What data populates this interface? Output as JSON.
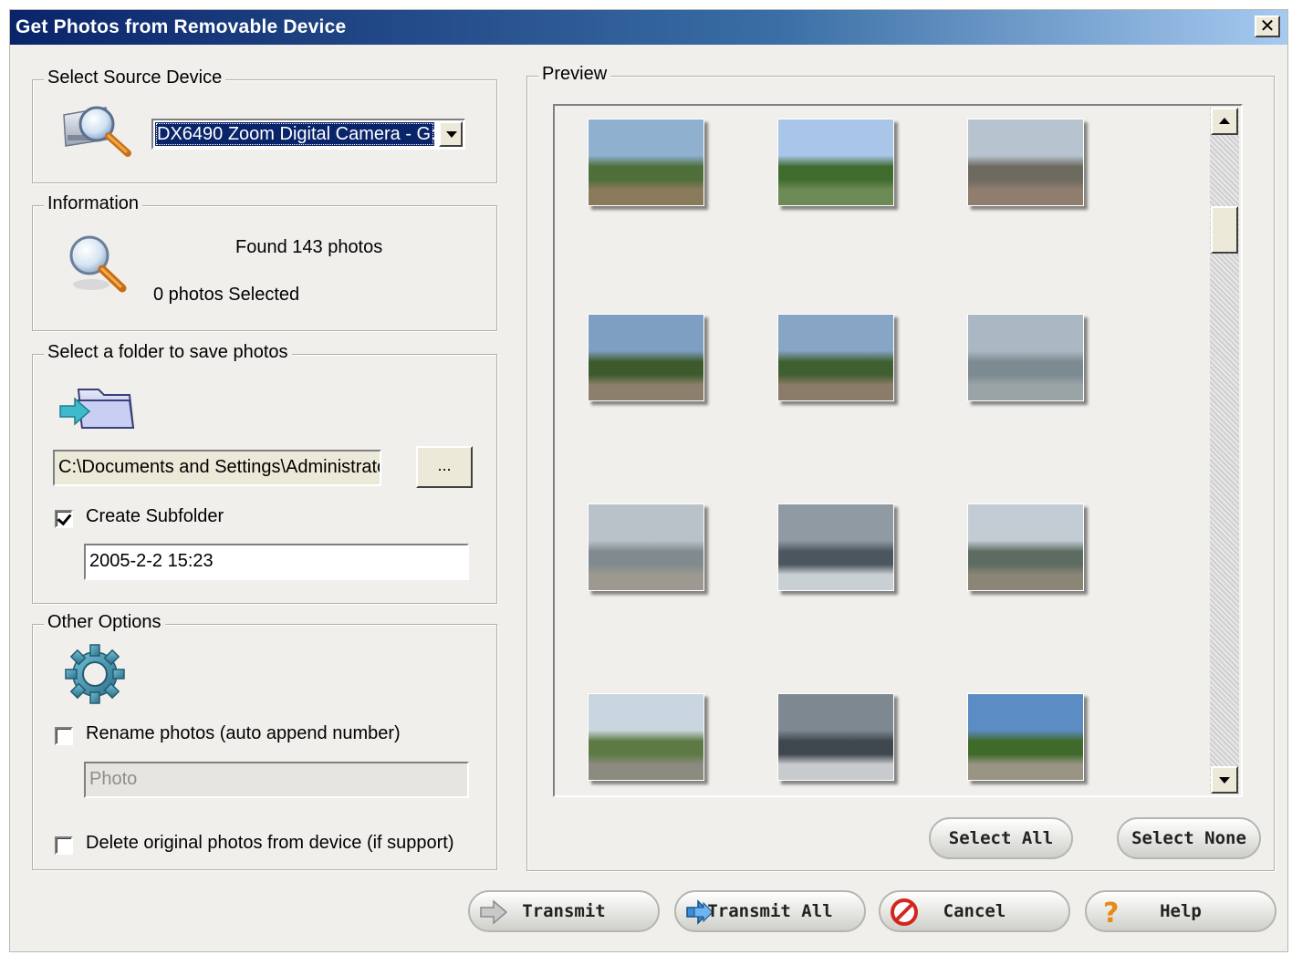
{
  "window": {
    "title": "Get Photos from Removable Device",
    "close_label": "✕"
  },
  "source": {
    "legend": "Select Source Device",
    "device_value": "DX6490 Zoom Digital Camera - G:",
    "device_icon": "device-search-icon"
  },
  "info": {
    "legend": "Information",
    "found_text": "Found 143 photos",
    "selected_text": "0 photos Selected",
    "info_icon": "magnifier-icon"
  },
  "folder": {
    "legend": "Select a folder to save photos",
    "path_value": "C:\\Documents and Settings\\Administrator\\My Documents",
    "browse_label": "...",
    "create_subfolder_label": "Create Subfolder",
    "create_subfolder_checked": true,
    "subfolder_value": "2005-2-2 15:23",
    "folder_icon": "folder-import-icon"
  },
  "options": {
    "legend": "Other Options",
    "rename_label": "Rename photos (auto append number)",
    "rename_checked": false,
    "rename_placeholder": "Photo",
    "delete_label": "Delete original photos from device (if support)",
    "delete_checked": false,
    "options_icon": "gear-icon"
  },
  "preview": {
    "legend": "Preview",
    "select_all_label": "Select All",
    "select_none_label": "Select None",
    "thumbnails": [
      {
        "scene": "palm-shore",
        "colors": [
          "#8fb0cf",
          "#4e6e3a",
          "#8a7a5c"
        ]
      },
      {
        "scene": "hill-house",
        "colors": [
          "#a9c6e8",
          "#3f6b2e",
          "#6c8a55"
        ]
      },
      {
        "scene": "promenade-rail",
        "colors": [
          "#b7c4cf",
          "#6d6a60",
          "#8f7e6e"
        ]
      },
      {
        "scene": "promenade-trees",
        "colors": [
          "#7f9fc2",
          "#3d5a2c",
          "#8c7f6b"
        ]
      },
      {
        "scene": "promenade-trees",
        "colors": [
          "#87a5c5",
          "#3f5f30",
          "#8a7c68"
        ]
      },
      {
        "scene": "sea-haze",
        "colors": [
          "#aab8c3",
          "#7c8a92",
          "#9aa3a6"
        ]
      },
      {
        "scene": "sea-curve",
        "colors": [
          "#b9c2c8",
          "#808a8f",
          "#9d9890"
        ]
      },
      {
        "scene": "sea-sunlight",
        "colors": [
          "#8f9aa3",
          "#4b565e",
          "#c9d0d4"
        ]
      },
      {
        "scene": "shore-palms",
        "colors": [
          "#c3ccd4",
          "#5d6c60",
          "#8b8576"
        ]
      },
      {
        "scene": "hill-buildings",
        "colors": [
          "#cad6df",
          "#5e7a44",
          "#8d8a80"
        ]
      },
      {
        "scene": "sea-dusk",
        "colors": [
          "#7e8890",
          "#3f474e",
          "#c7cbce"
        ]
      },
      {
        "scene": "palm-walk",
        "colors": [
          "#5c8cc4",
          "#3f6a2a",
          "#9a9485"
        ]
      }
    ]
  },
  "footer": {
    "transmit_label": "Transmit",
    "transmit_all_label": "Transmit All",
    "cancel_label": "Cancel",
    "help_label": "Help"
  }
}
